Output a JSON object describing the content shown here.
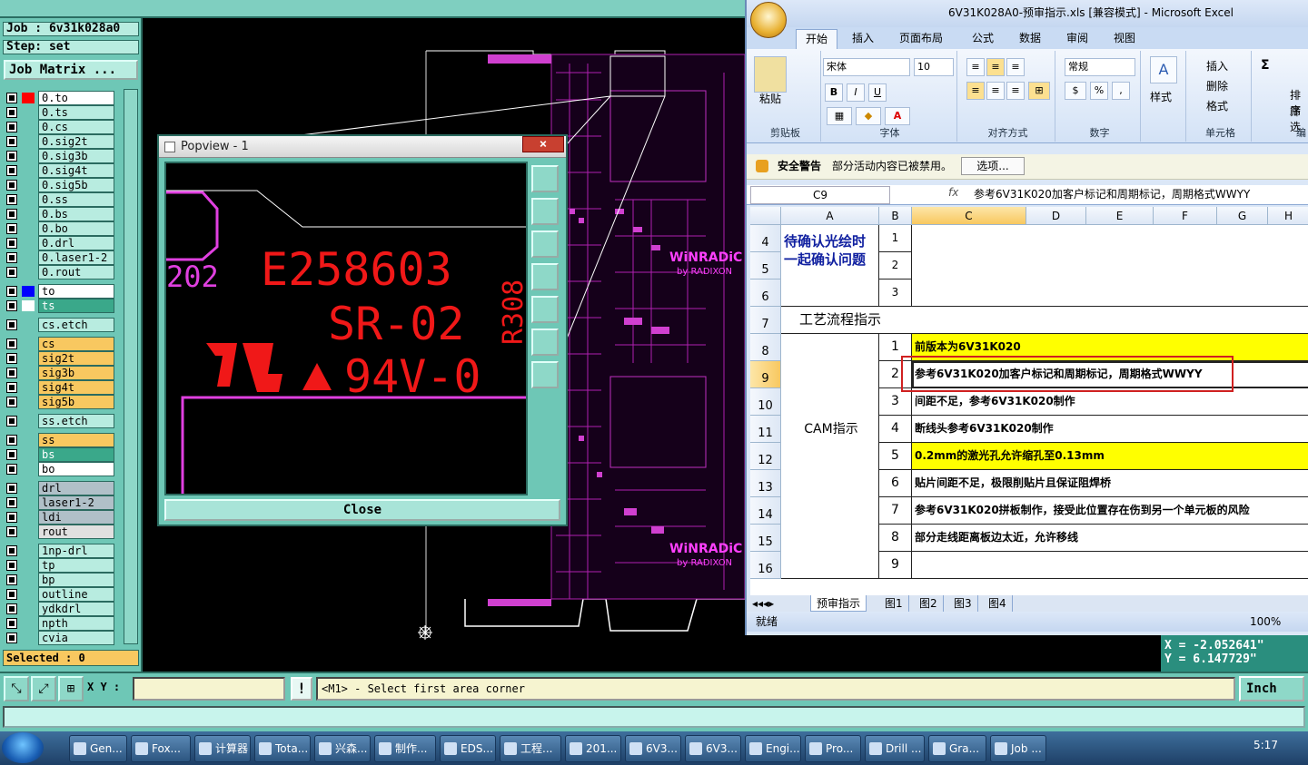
{
  "genesis": {
    "job_label": "Job : 6v31k028a0",
    "step_label": "Step: set",
    "job_matrix_button": "Job Matrix ...",
    "layers": [
      {
        "name": "0.to",
        "bg": "#ffffff",
        "color": "#ff0000"
      },
      {
        "name": "0.ts",
        "bg": "#b8ece0",
        "color": ""
      },
      {
        "name": "0.cs",
        "bg": "#b8ece0",
        "color": ""
      },
      {
        "name": "0.sig2t",
        "bg": "#b8ece0",
        "color": ""
      },
      {
        "name": "0.sig3b",
        "bg": "#b8ece0",
        "color": ""
      },
      {
        "name": "0.sig4t",
        "bg": "#b8ece0",
        "color": ""
      },
      {
        "name": "0.sig5b",
        "bg": "#b8ece0",
        "color": ""
      },
      {
        "name": "0.ss",
        "bg": "#b8ece0",
        "color": ""
      },
      {
        "name": "0.bs",
        "bg": "#b8ece0",
        "color": ""
      },
      {
        "name": "0.bo",
        "bg": "#b8ece0",
        "color": ""
      },
      {
        "name": "0.drl",
        "bg": "#b8ece0",
        "color": ""
      },
      {
        "name": "0.laser1-2",
        "bg": "#b8ece0",
        "color": ""
      },
      {
        "name": "0.rout",
        "bg": "#b8ece0",
        "color": ""
      },
      {
        "name": "to",
        "bg": "#ffffff",
        "color": "#0000ff"
      },
      {
        "name": "ts",
        "bg": "#3aa88a",
        "color": "#ffffff"
      },
      {
        "name": "cs.etch",
        "bg": "#b8ece0",
        "color": ""
      },
      {
        "name": "cs",
        "bg": "#f8c860",
        "color": ""
      },
      {
        "name": "sig2t",
        "bg": "#f8c860",
        "color": ""
      },
      {
        "name": "sig3b",
        "bg": "#f8c860",
        "color": ""
      },
      {
        "name": "sig4t",
        "bg": "#f8c860",
        "color": ""
      },
      {
        "name": "sig5b",
        "bg": "#f8c860",
        "color": ""
      },
      {
        "name": "ss.etch",
        "bg": "#b8ece0",
        "color": ""
      },
      {
        "name": "ss",
        "bg": "#f8c860",
        "color": ""
      },
      {
        "name": "bs",
        "bg": "#3aa88a",
        "color": ""
      },
      {
        "name": "bo",
        "bg": "#ffffff",
        "color": ""
      },
      {
        "name": "drl",
        "bg": "#b0c0c8",
        "color": ""
      },
      {
        "name": "laser1-2",
        "bg": "#b0c0c8",
        "color": ""
      },
      {
        "name": "ldi",
        "bg": "#b0c0c8",
        "color": ""
      },
      {
        "name": "rout",
        "bg": "#e0e0e0",
        "color": ""
      },
      {
        "name": "1np-drl",
        "bg": "#b8ece0",
        "color": ""
      },
      {
        "name": "tp",
        "bg": "#b8ece0",
        "color": ""
      },
      {
        "name": "bp",
        "bg": "#b8ece0",
        "color": ""
      },
      {
        "name": "outline",
        "bg": "#b8ece0",
        "color": ""
      },
      {
        "name": "ydkdrl",
        "bg": "#b8ece0",
        "color": ""
      },
      {
        "name": "npth",
        "bg": "#b8ece0",
        "color": ""
      },
      {
        "name": "cvia",
        "bg": "#b8ece0",
        "color": ""
      }
    ],
    "selected_label": "Selected : 0",
    "xy_label": "X Y :",
    "xy_value": "",
    "message": "<M1> - Select first area corner",
    "units": "Inch",
    "coord_x": "X = -2.052641\"",
    "coord_y": "Y = 6.147729\"",
    "board_labels": {
      "winradic": "WiNRADiC",
      "by_radixon": "by RADIXON"
    }
  },
  "popview": {
    "title": "Popview - 1",
    "close_x": "×",
    "close_button": "Close",
    "text_line1": "E258603",
    "text_line2": "SR-02",
    "text_line3": "94V-0",
    "text_side": "R308",
    "text_left": "202"
  },
  "excel": {
    "title": "6V31K028A0-预审指示.xls [兼容模式] - Microsoft Excel",
    "tabs": [
      "开始",
      "插入",
      "页面布局",
      "公式",
      "数据",
      "审阅",
      "视图"
    ],
    "groups": {
      "clipboard": "剪贴板",
      "font": "字体",
      "align": "对齐方式",
      "number": "数字",
      "cells": "单元格",
      "edit": "编"
    },
    "paste_label": "粘贴",
    "font_name": "宋体",
    "font_size": "10",
    "number_format": "常规",
    "style_label": "样式",
    "insert_label": "插入",
    "delete_label": "删除",
    "format_label": "格式",
    "sort_label": "排序",
    "filter_label": "筛选",
    "security_title": "安全警告",
    "security_msg": "部分活动内容已被禁用。",
    "options_button": "选项...",
    "name_box": "C9",
    "fx": "fx",
    "formula": "参考6V31K020加客户标记和周期标记，周期格式WWYY",
    "columns": [
      "A",
      "B",
      "C",
      "D",
      "E",
      "F",
      "G",
      "H"
    ],
    "rows": [
      "4",
      "5",
      "6",
      "7",
      "8",
      "9",
      "10",
      "11",
      "12",
      "13",
      "14",
      "15",
      "16"
    ],
    "a_confirm": "待确认光绘时一起确认问题",
    "a_process": "工艺流程指示",
    "a_cam": "CAM指示",
    "b_top": [
      "1",
      "2",
      "3"
    ],
    "items": [
      {
        "n": "1",
        "text": "前版本为6V31K020",
        "hl": true
      },
      {
        "n": "2",
        "text": "参考6V31K020加客户标记和周期标记，周期格式WWYY",
        "hl": false
      },
      {
        "n": "3",
        "text": "间距不足，参考6V31K020制作",
        "hl": false
      },
      {
        "n": "4",
        "text": "断线头参考6V31K020制作",
        "hl": false
      },
      {
        "n": "5",
        "text": "0.2mm的激光孔允许缩孔至0.13mm",
        "hl": true
      },
      {
        "n": "6",
        "text": "贴片间距不足，极限削贴片且保证阻焊桥",
        "hl": false
      },
      {
        "n": "7",
        "text": "参考6V31K020拼板制作，接受此位置存在伤到另一个单元板的风险",
        "hl": false
      },
      {
        "n": "8",
        "text": "部分走线距离板边太近，允许移线",
        "hl": false
      },
      {
        "n": "9",
        "text": "",
        "hl": false
      }
    ],
    "sheets": [
      "预审指示",
      "图1",
      "图2",
      "图3",
      "图4"
    ],
    "status": "就绪",
    "zoom": "100%"
  },
  "taskbar": {
    "items": [
      "Gen...",
      "Fox...",
      "计算器",
      "Tota...",
      "兴森...",
      "制作...",
      "EDS...",
      "工程...",
      "201...",
      "6V3...",
      "6V3...",
      "Engi...",
      "Pro...",
      "Drill ...",
      "Gra...",
      "Job ..."
    ],
    "clock": "5:17"
  }
}
